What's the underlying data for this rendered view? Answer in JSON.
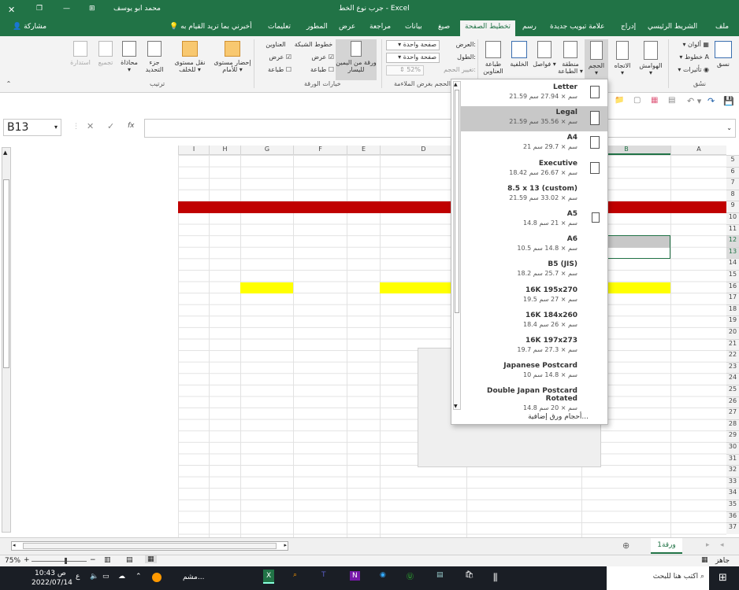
{
  "title_bar": {
    "doc_title": "جرب نوع الخط - Excel",
    "user": "محمد ابو يوسف"
  },
  "tabs": [
    "ملف",
    "الشريط الرئيسي",
    "إدراج",
    "علامة تبويب جديدة",
    "رسم",
    "تخطيط الصفحة",
    "صيغ",
    "بيانات",
    "مراجعة",
    "عرض",
    "المطور",
    "تعليمات"
  ],
  "active_tab": "تخطيط الصفحة",
  "tell_me": "أخبرني بما تريد القيام به",
  "share": "مشاركة",
  "ribbon": {
    "themes": {
      "label": "نسُق",
      "themes_btn": "نسق",
      "colors": "ألوان",
      "fonts": "خطوط",
      "effects": "تأثيرات"
    },
    "page_setup": {
      "margins": "الهوامش",
      "orientation": "الاتجاه",
      "size": "الحجم",
      "print_area": "منطقة الطباعة",
      "breaks": "فواصل",
      "background": "الخلفية",
      "print_titles": "طباعة العناوين"
    },
    "scale": {
      "width_label": "العرض:",
      "width_val": "صفحة واحدة",
      "height_label": "الطول:",
      "height_val": "صفحة واحدة",
      "scale_label": "تغيير الحجم:",
      "scale_val": "52%",
      "group": "تغيير الحجم بغرض الملاءمة"
    },
    "sheet_options": {
      "gridlines": "خطوط الشبكة",
      "headings": "العناوين",
      "view": "عرض",
      "print": "طباعة",
      "rtl": "ورقة من اليمين لليسار",
      "group": "خيارات الورقة"
    },
    "arrange": {
      "bring_forward": "إحضار مستوى للأمام",
      "send_backward": "نقل مستوى للخلف",
      "selection_pane": "جزء التحديد",
      "align": "محاذاة",
      "group_btn": "تجميع",
      "rotate": "استدارة",
      "group": "ترتيب"
    }
  },
  "name_box": "B13",
  "fx": "fx",
  "columns": [
    "A",
    "B",
    "C",
    "D",
    "E",
    "F",
    "G",
    "H",
    "I",
    "J"
  ],
  "selected_column": "B",
  "rows": [
    "5",
    "6",
    "7",
    "8",
    "9",
    "10",
    "11",
    "12",
    "13",
    "14",
    "15",
    "16",
    "17",
    "18",
    "19",
    "20",
    "21",
    "22",
    "23",
    "24",
    "25",
    "26",
    "27",
    "28",
    "29",
    "30",
    "31",
    "32",
    "33",
    "34",
    "35",
    "36",
    "37"
  ],
  "selected_rows": [
    "12",
    "13"
  ],
  "paper_sizes": [
    {
      "name": "Letter",
      "dims": "21.59 سم × 27.94 سم"
    },
    {
      "name": "Legal",
      "dims": "21.59 سم × 35.56 سم"
    },
    {
      "name": "A4",
      "dims": "21 سم × 29.7 سم"
    },
    {
      "name": "Executive",
      "dims": "18.42 سم × 26.67 سم"
    },
    {
      "name": "8.5 x 13 (custom)",
      "dims": "21.59 سم × 33.02 سم"
    },
    {
      "name": "A5",
      "dims": "14.8 سم × 21 سم"
    },
    {
      "name": "A6",
      "dims": "10.5 سم × 14.8 سم"
    },
    {
      "name": "B5 (JIS)",
      "dims": "18.2 سم × 25.7 سم"
    },
    {
      "name": "16K 195x270",
      "dims": "19.5 سم × 27 سم"
    },
    {
      "name": "16K 184x260",
      "dims": "18.4 سم × 26 سم"
    },
    {
      "name": "16K 197x273",
      "dims": "19.7 سم × 27.3 سم"
    },
    {
      "name": "Japanese Postcard",
      "dims": "10 سم × 14.8 سم"
    },
    {
      "name": "Double Japan Postcard Rotated",
      "dims": "14.8 سم × 20 سم"
    }
  ],
  "selected_paper": "Legal",
  "more_sizes": "أحجام ورق إضافية...",
  "sheet_tab": "ورقة1",
  "status": {
    "ready": "جاهز",
    "zoom": "75%"
  },
  "taskbar": {
    "search": "اكتب هنا للبحث",
    "time": "10:43 ص",
    "date": "2022/07/14",
    "lang": "ع",
    "app": "مشم..."
  },
  "colors": {
    "brand": "#217346",
    "red_fill": "#c00000",
    "yellow_fill": "#ffff00"
  }
}
